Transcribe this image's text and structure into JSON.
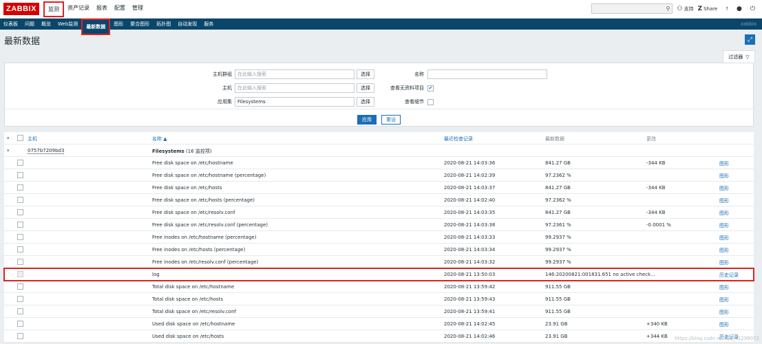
{
  "topbar": {
    "logo": "ZABBIX",
    "menu": [
      "监测",
      "资产记录",
      "报表",
      "配置",
      "管理"
    ],
    "active_menu": "监测",
    "support": "支持",
    "share": "Share",
    "help": "?",
    "user_icon": "user-icon",
    "power_icon": "power-icon"
  },
  "subnav": {
    "items": [
      "仪表板",
      "问题",
      "概览",
      "Web监测",
      "最新数据",
      "图形",
      "聚合图形",
      "拓扑图",
      "自动发现",
      "服务"
    ],
    "active": "最新数据",
    "brand": "zabbix"
  },
  "page": {
    "title": "最新数据"
  },
  "filter": {
    "tab_label": "过滤器",
    "host_groups_label": "主机群组",
    "host_groups_placeholder": "在此输入搜索",
    "hosts_label": "主机",
    "hosts_placeholder": "在此输入搜索",
    "application_label": "应用集",
    "application_value": "Filesystems",
    "select_label": "选择",
    "name_label": "名称",
    "name_value": "",
    "show_no_data_label": "查看无资料项目",
    "show_no_data_checked": true,
    "show_details_label": "查看细节",
    "show_details_checked": false,
    "apply_label": "应用",
    "reset_label": "重设"
  },
  "table": {
    "headers": {
      "host": "主机",
      "name": "名称 ▲",
      "last_check": "最近检查记录",
      "last_value": "最新数据",
      "change": "更改"
    },
    "host": "0757b7209bd3",
    "group_label": "Filesystems",
    "group_count": "(16 监控项)",
    "rows": [
      {
        "name": "Free disk space on /etc/hostname",
        "time": "2020-08-21 14:03:36",
        "value": "841.27 GB",
        "change": "-344 KB",
        "action": "图形"
      },
      {
        "name": "Free disk space on /etc/hostname (percentage)",
        "time": "2020-08-21 14:02:39",
        "value": "97.2362 %",
        "change": "",
        "action": "图形"
      },
      {
        "name": "Free disk space on /etc/hosts",
        "time": "2020-08-21 14:03:37",
        "value": "841.27 GB",
        "change": "-344 KB",
        "action": "图形"
      },
      {
        "name": "Free disk space on /etc/hosts (percentage)",
        "time": "2020-08-21 14:02:40",
        "value": "97.2362 %",
        "change": "",
        "action": "图形"
      },
      {
        "name": "Free disk space on /etc/resolv.conf",
        "time": "2020-08-21 14:03:35",
        "value": "841.27 GB",
        "change": "-344 KB",
        "action": "图形"
      },
      {
        "name": "Free disk space on /etc/resolv.conf (percentage)",
        "time": "2020-08-21 14:03:38",
        "value": "97.2361 %",
        "change": "-0.0001 %",
        "action": "图形"
      },
      {
        "name": "Free inodes on /etc/hostname (percentage)",
        "time": "2020-08-21 14:03:33",
        "value": "99.2937 %",
        "change": "",
        "action": "图形"
      },
      {
        "name": "Free inodes on /etc/hosts (percentage)",
        "time": "2020-08-21 14:03:34",
        "value": "99.2937 %",
        "change": "",
        "action": "图形"
      },
      {
        "name": "Free inodes on /etc/resolv.conf (percentage)",
        "time": "2020-08-21 14:03:32",
        "value": "99.2937 %",
        "change": "",
        "action": "图形"
      },
      {
        "name": "log",
        "time": "2020-08-21 13:50:03",
        "value": "146:20200821:001831.651 no active check…",
        "change": "",
        "action": "历史记录"
      },
      {
        "name": "Total disk space on /etc/hostname",
        "time": "2020-08-21 13:59:42",
        "value": "911.55 GB",
        "change": "",
        "action": "图形"
      },
      {
        "name": "Total disk space on /etc/hosts",
        "time": "2020-08-21 13:59:43",
        "value": "911.55 GB",
        "change": "",
        "action": "图形"
      },
      {
        "name": "Total disk space on /etc/resolv.conf",
        "time": "2020-08-21 13:59:41",
        "value": "911.55 GB",
        "change": "",
        "action": "图形"
      },
      {
        "name": "Used disk space on /etc/hostname",
        "time": "2020-08-21 14:02:45",
        "value": "23.91 GB",
        "change": "+340 KB",
        "action": "图形"
      },
      {
        "name": "Used disk space on /etc/hosts",
        "time": "2020-08-21 14:02:46",
        "value": "23.91 GB",
        "change": "+344 KB",
        "action": "历史记录"
      }
    ]
  },
  "watermark": "https://blog.csdn.net/qq_41299072"
}
